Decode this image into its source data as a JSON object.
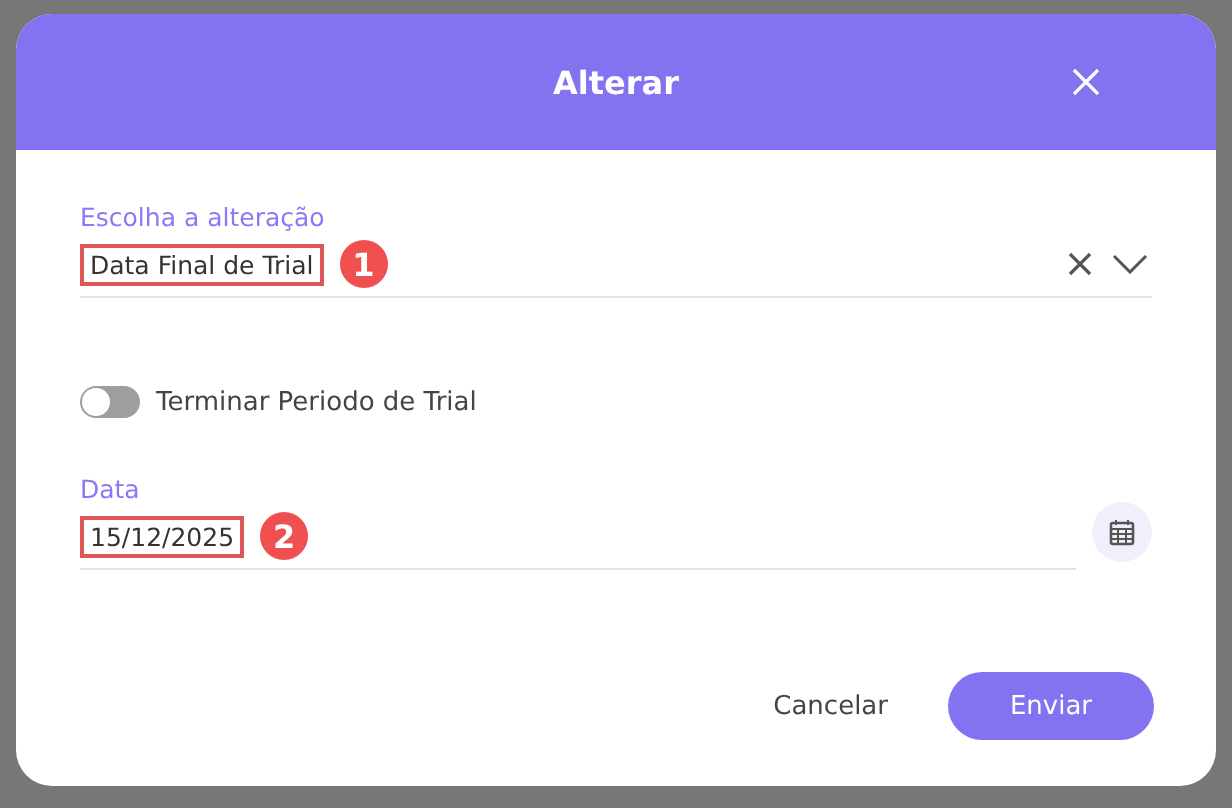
{
  "dialog": {
    "title": "Alterar",
    "fields": [
      {
        "kind": "select",
        "label": "Escolha a alteração",
        "value": "Data Final de Trial",
        "marker": "1"
      },
      {
        "kind": "toggle",
        "label": "Terminar Periodo de Trial",
        "on": false
      },
      {
        "kind": "date",
        "label": "Data",
        "value": "15/12/2025",
        "marker": "2"
      }
    ],
    "buttons": [
      {
        "label": "Cancelar",
        "kind": "text"
      },
      {
        "label": "Enviar",
        "kind": "primary"
      }
    ]
  }
}
